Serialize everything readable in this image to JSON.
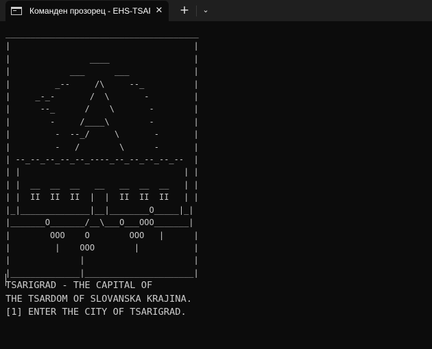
{
  "window": {
    "tab_title": "Команден прозорец - EHS-TSARIGRAD",
    "tab_icon": "console-icon",
    "close_icon": "close-icon",
    "new_tab_icon": "plus-icon",
    "dropdown_icon": "chevron-down-icon",
    "close_glyph": "✕",
    "new_tab_glyph": "+",
    "dropdown_glyph": "⌄"
  },
  "console": {
    "art_lines": [
      "_______________________________________",
      "|                                     |",
      "|                ____                 |",
      "|            ___      ___             |",
      "|         _--     /\\     --_          |",
      "|     _-_-       /  \\       -         |",
      "|      --_      /    \\       -        |",
      "|        -     /____\\        -        |",
      "|         -  --_/     \\       -       |",
      "|         -   /        \\      -       |",
      "| --_--_--_--_--_----_--_--_--_--_--  |",
      "| |                                 | |",
      "| |  __  __  __   __   __  __  __   | |",
      "| |  II  II  II  |  |  II  II  II   | |",
      "|_|______________|__|________O_____|_|",
      "|_______O_______/__\\___O___OOO_______|",
      "|        OOO    O        OOO   |      |",
      "|         |    OOO        |           |",
      "|              |                      |",
      "|______________|______________________|"
    ],
    "messages": [
      "TSARIGRAD - THE CAPITAL OF",
      "THE TSARDOM OF SLOVANSKA KRAJINA.",
      "[1] ENTER THE CITY OF TSARIGRAD."
    ]
  },
  "colors": {
    "background": "#0c0c0c",
    "titlebar": "#1f1f1f",
    "text": "#cccccc"
  }
}
